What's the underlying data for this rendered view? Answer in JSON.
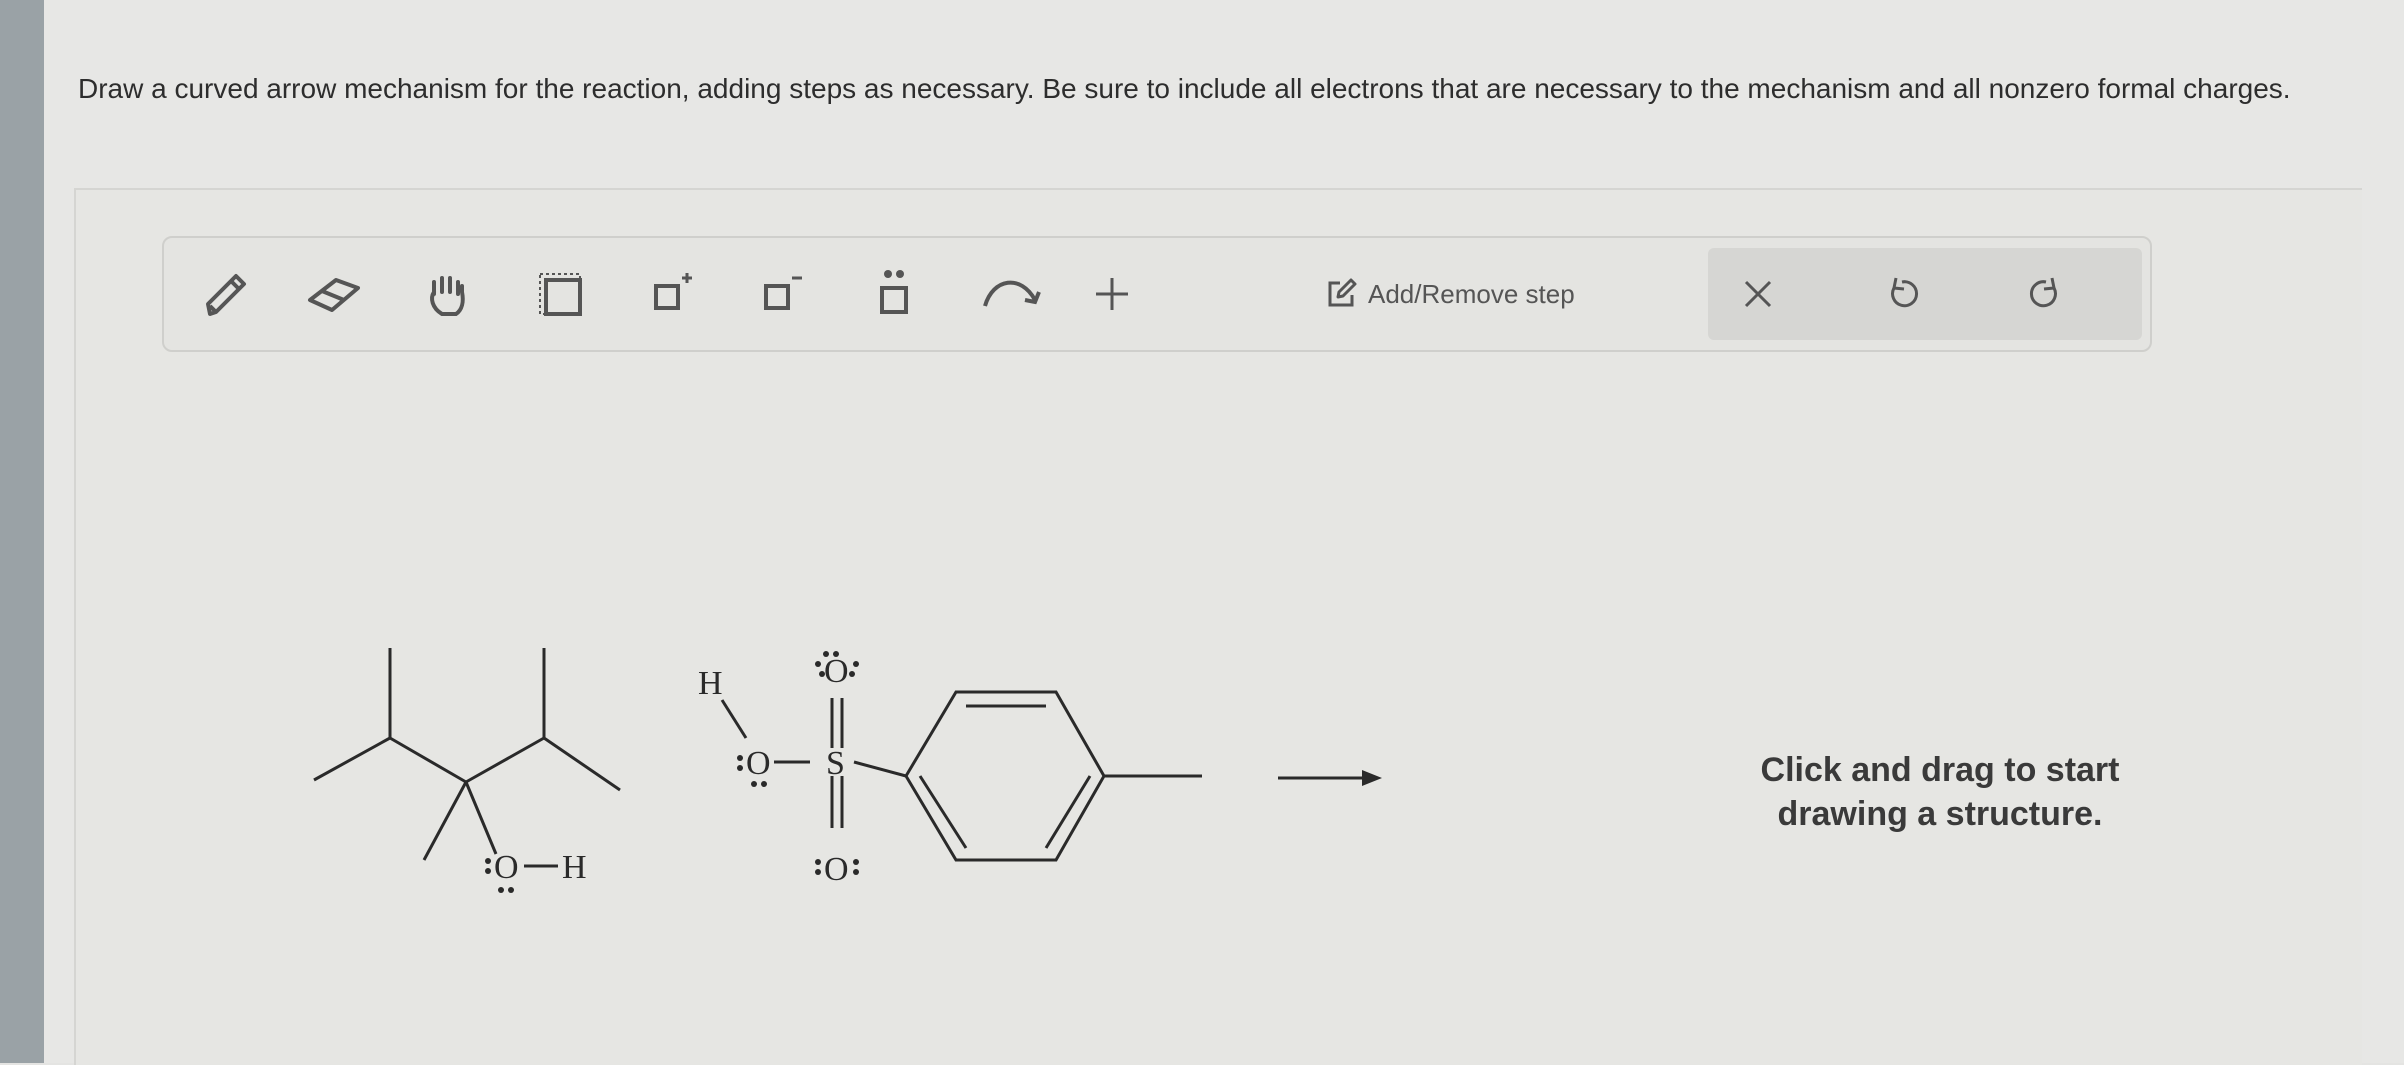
{
  "prompt": "Draw a curved arrow mechanism for the reaction, adding steps as necessary. Be sure to include all electrons that are necessary to the mechanism and all nonzero formal charges.",
  "toolbar": {
    "tools": [
      "pencil-icon",
      "eraser-icon",
      "hand-icon",
      "select-box-icon",
      "positive-charge-icon",
      "negative-charge-icon",
      "lone-pair-icon",
      "curved-arrow-icon",
      "plus-icon"
    ],
    "step_label": "Add/Remove step",
    "actions": [
      "close-icon",
      "undo-icon",
      "redo-icon"
    ]
  },
  "structures": {
    "alcohol": {
      "oxygen": "O",
      "hydrogen": "H"
    },
    "tsoh": {
      "hydrogen": "H",
      "hydroxyl_oxygen": "O",
      "sulfur": "S",
      "top_oxygen": "O",
      "bottom_oxygen": "O"
    }
  },
  "canvas": {
    "hint": "Click and drag to start drawing a structure."
  },
  "colors": {
    "icon": "#555555",
    "text": "#2d2d2d",
    "bond": "#2a2a2a"
  }
}
